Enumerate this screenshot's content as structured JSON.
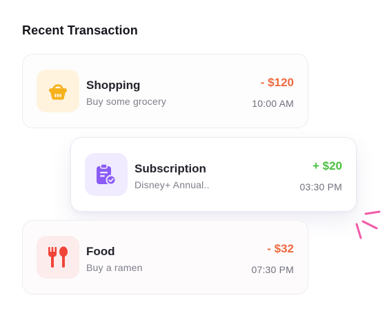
{
  "section_title": "Recent Transaction",
  "transactions": [
    {
      "title": "Shopping",
      "description": "Buy some grocery",
      "amount": "- $120",
      "time": "10:00 AM",
      "icon": "shopping-basket-icon",
      "amount_color": "#f0693e",
      "icon_color": "#f6b21c",
      "icon_bg": "#fff3de"
    },
    {
      "title": "Subscription",
      "description": "Disney+ Annual..",
      "amount": "+ $20",
      "time": "03:30 PM",
      "icon": "subscription-clipboard-icon",
      "amount_color": "#4bbf43",
      "icon_color": "#8b5cf6",
      "icon_bg": "#f0ebff"
    },
    {
      "title": "Food",
      "description": "Buy a ramen",
      "amount": "- $32",
      "time": "07:30 PM",
      "icon": "fork-spoon-icon",
      "amount_color": "#f0693e",
      "icon_color": "#f04438",
      "icon_bg": "#fdecec"
    }
  ],
  "accent_color": "#f25aa8"
}
